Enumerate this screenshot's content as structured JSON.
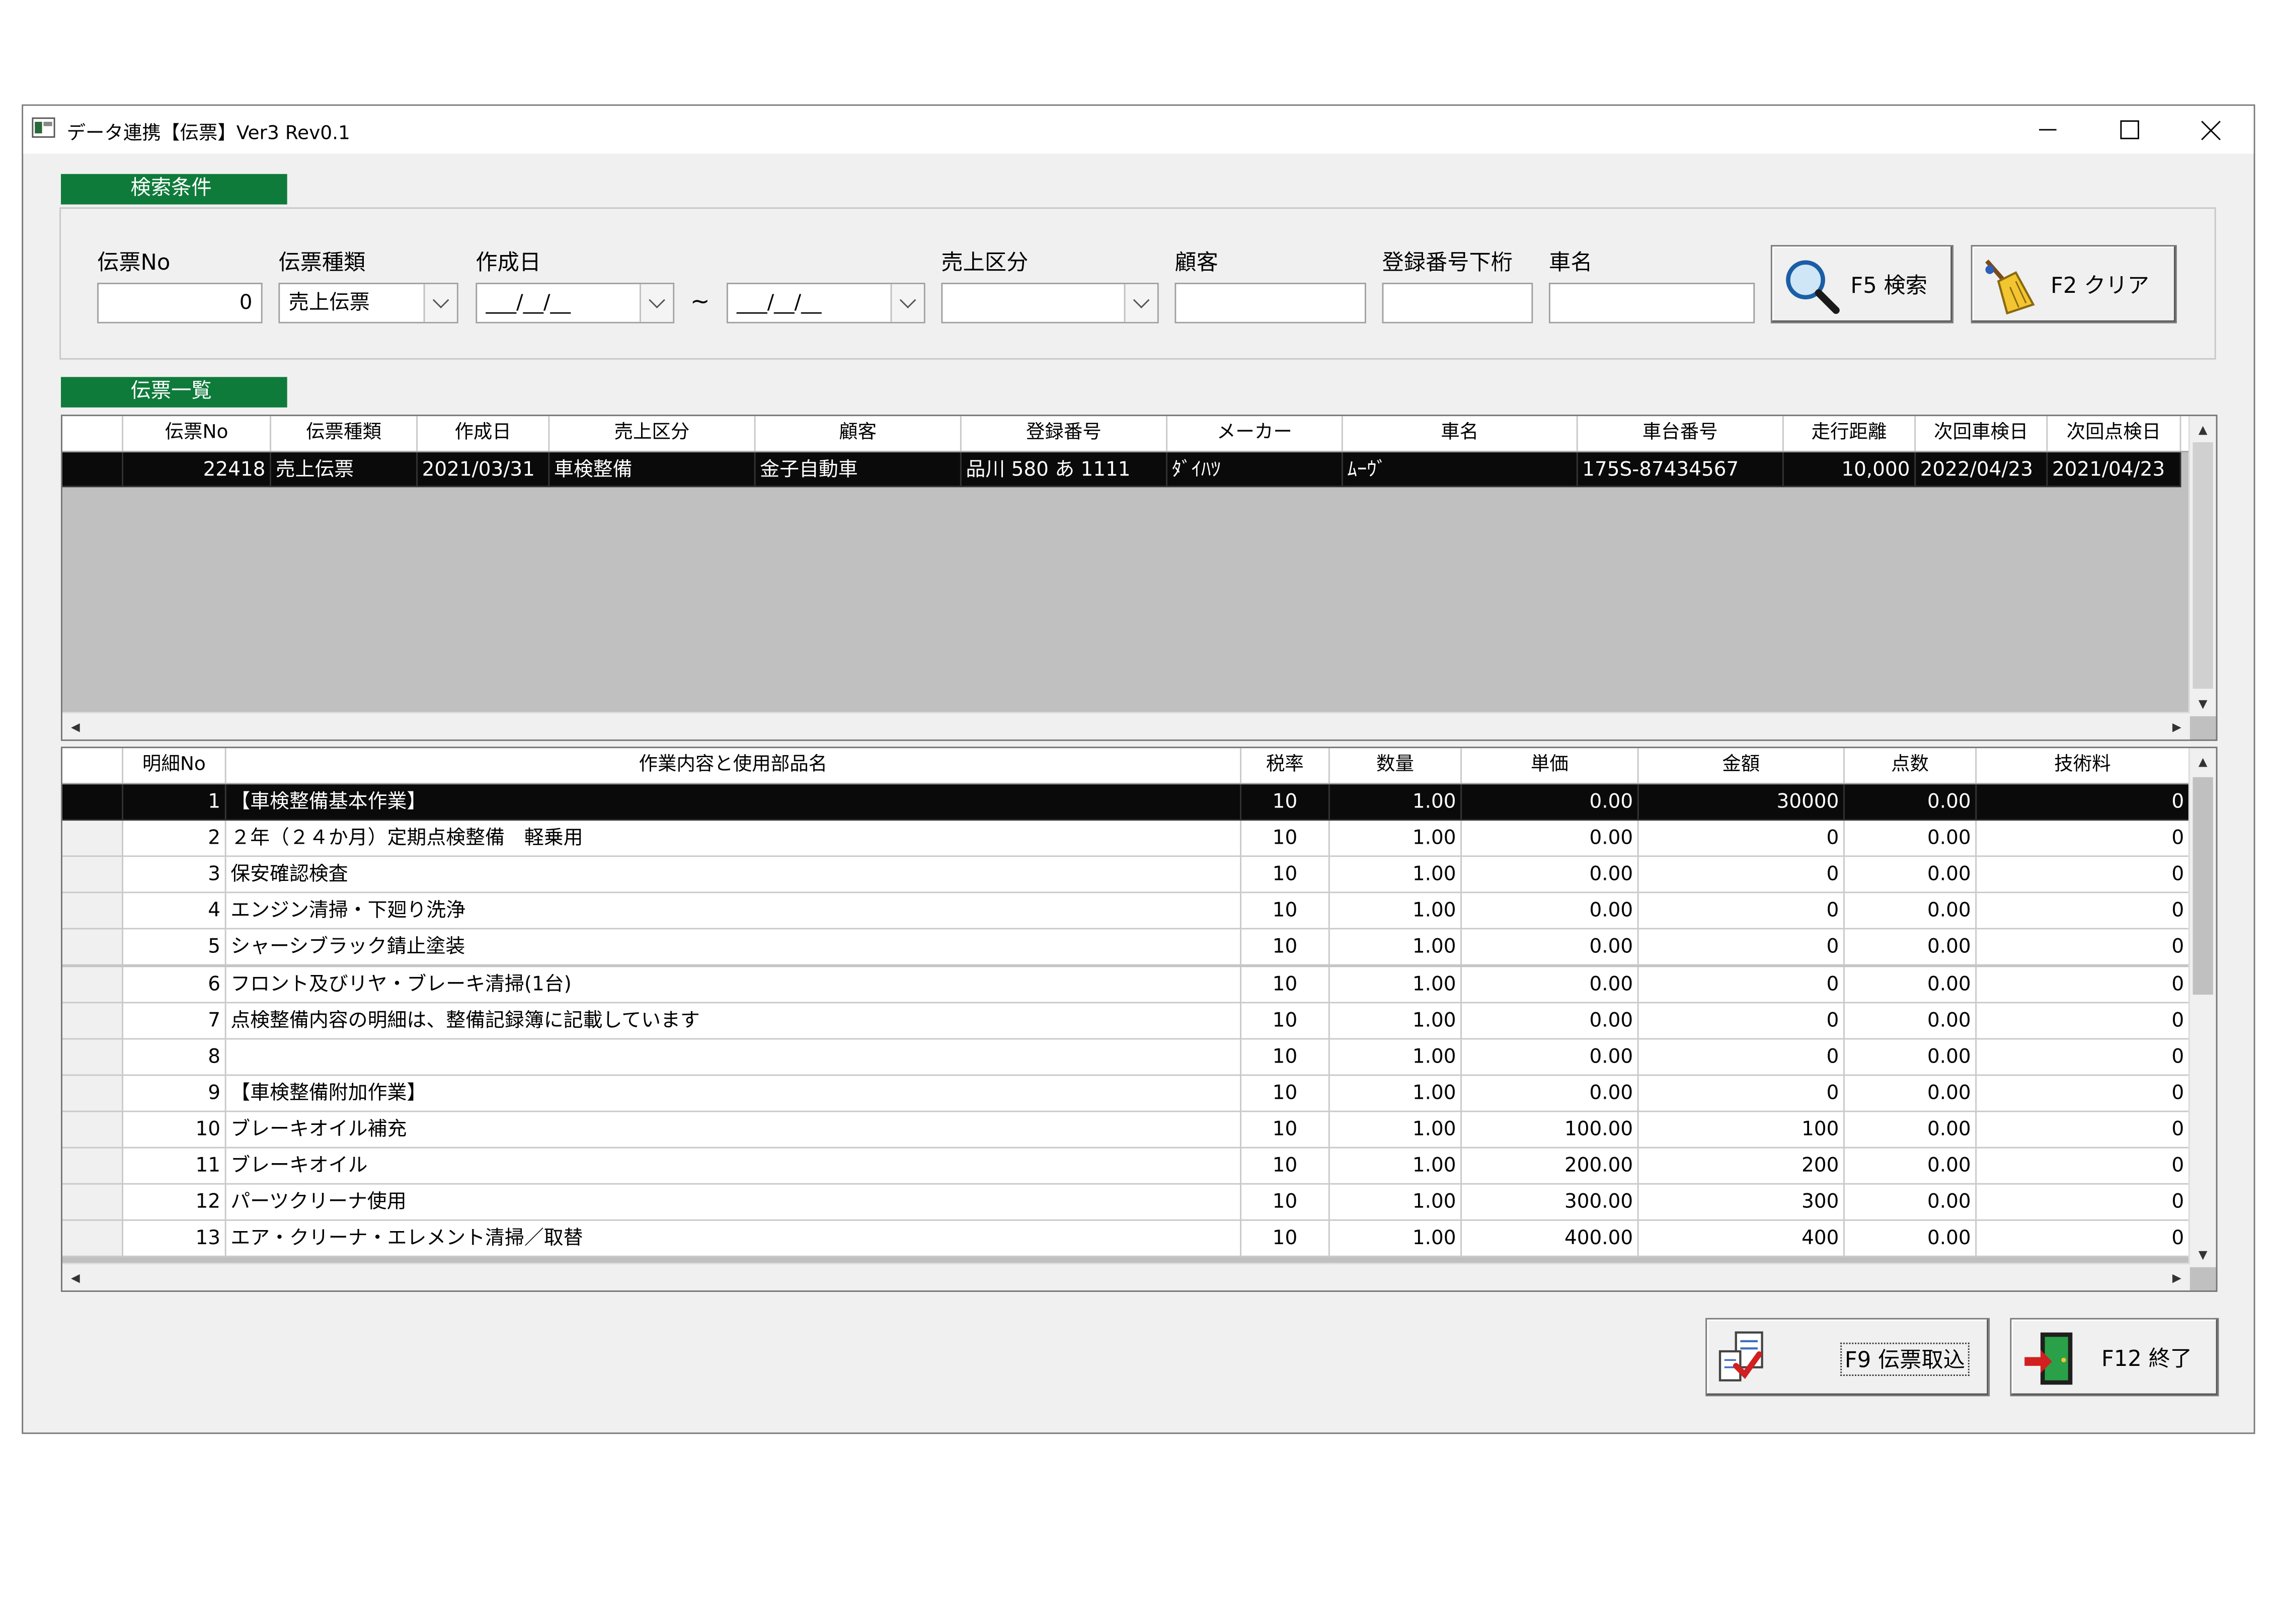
{
  "window": {
    "title": "データ連携【伝票】Ver3 Rev0.1"
  },
  "search": {
    "section_label": "検索条件",
    "slip_no_label": "伝票No",
    "slip_no_value": "0",
    "slip_type_label": "伝票種類",
    "slip_type_value": "売上伝票",
    "date_label": "作成日",
    "date_from": "___/__/__",
    "date_tilde": "~",
    "date_to": "___/__/__",
    "sales_category_label": "売上区分",
    "sales_category_value": "",
    "customer_label": "顧客",
    "customer_value": "",
    "reg_no_label": "登録番号下桁",
    "reg_no_value": "",
    "car_name_label": "車名",
    "car_name_value": "",
    "search_button": "F5 検索",
    "clear_button": "F2 クリア"
  },
  "slip_list": {
    "section_label": "伝票一覧",
    "columns": [
      "伝票No",
      "伝票種類",
      "作成日",
      "売上区分",
      "顧客",
      "登録番号",
      "メーカー",
      "車名",
      "車台番号",
      "走行距離",
      "次回車検日",
      "次回点検日"
    ],
    "rows": [
      [
        "22418",
        "売上伝票",
        "2021/03/31",
        "車検整備",
        "金子自動車",
        "品川 580 あ 1111",
        "ﾀﾞｲﾊﾂ",
        "ﾑｰｳﾞ",
        "175S-87434567",
        "10,000",
        "2022/04/23",
        "2021/04/23"
      ]
    ]
  },
  "detail": {
    "columns": [
      "明細No",
      "作業内容と使用部品名",
      "税率",
      "数量",
      "単価",
      "金額",
      "点数",
      "技術料"
    ],
    "rows": [
      [
        "1",
        "【車検整備基本作業】",
        "10",
        "1.00",
        "0.00",
        "30000",
        "0.00",
        "0"
      ],
      [
        "2",
        "２年（２４か月）定期点検整備　軽乗用",
        "10",
        "1.00",
        "0.00",
        "0",
        "0.00",
        "0"
      ],
      [
        "3",
        "保安確認検査",
        "10",
        "1.00",
        "0.00",
        "0",
        "0.00",
        "0"
      ],
      [
        "4",
        "エンジン清掃・下廻り洗浄",
        "10",
        "1.00",
        "0.00",
        "0",
        "0.00",
        "0"
      ],
      [
        "5",
        "シャーシブラック錆止塗装",
        "10",
        "1.00",
        "0.00",
        "0",
        "0.00",
        "0"
      ],
      [
        "6",
        "フロント及びリヤ・ブレーキ清掃(1台)",
        "10",
        "1.00",
        "0.00",
        "0",
        "0.00",
        "0"
      ],
      [
        "7",
        "点検整備内容の明細は、整備記録簿に記載しています",
        "10",
        "1.00",
        "0.00",
        "0",
        "0.00",
        "0"
      ],
      [
        "8",
        "",
        "10",
        "1.00",
        "0.00",
        "0",
        "0.00",
        "0"
      ],
      [
        "9",
        "【車検整備附加作業】",
        "10",
        "1.00",
        "0.00",
        "0",
        "0.00",
        "0"
      ],
      [
        "10",
        "ブレーキオイル補充",
        "10",
        "1.00",
        "100.00",
        "100",
        "0.00",
        "0"
      ],
      [
        "11",
        "ブレーキオイル",
        "10",
        "1.00",
        "200.00",
        "200",
        "0.00",
        "0"
      ],
      [
        "12",
        "パーツクリーナ使用",
        "10",
        "1.00",
        "300.00",
        "300",
        "0.00",
        "0"
      ],
      [
        "13",
        "エア・クリーナ・エレメント清掃／取替",
        "10",
        "1.00",
        "400.00",
        "400",
        "0.00",
        "0"
      ]
    ]
  },
  "footer": {
    "import_button": "F9 伝票取込",
    "exit_button": "F12 終了"
  },
  "colors": {
    "accent_green": "#0f7b3b",
    "selection": "#0a0a0a",
    "grid_bg": "#c0c0c0"
  }
}
